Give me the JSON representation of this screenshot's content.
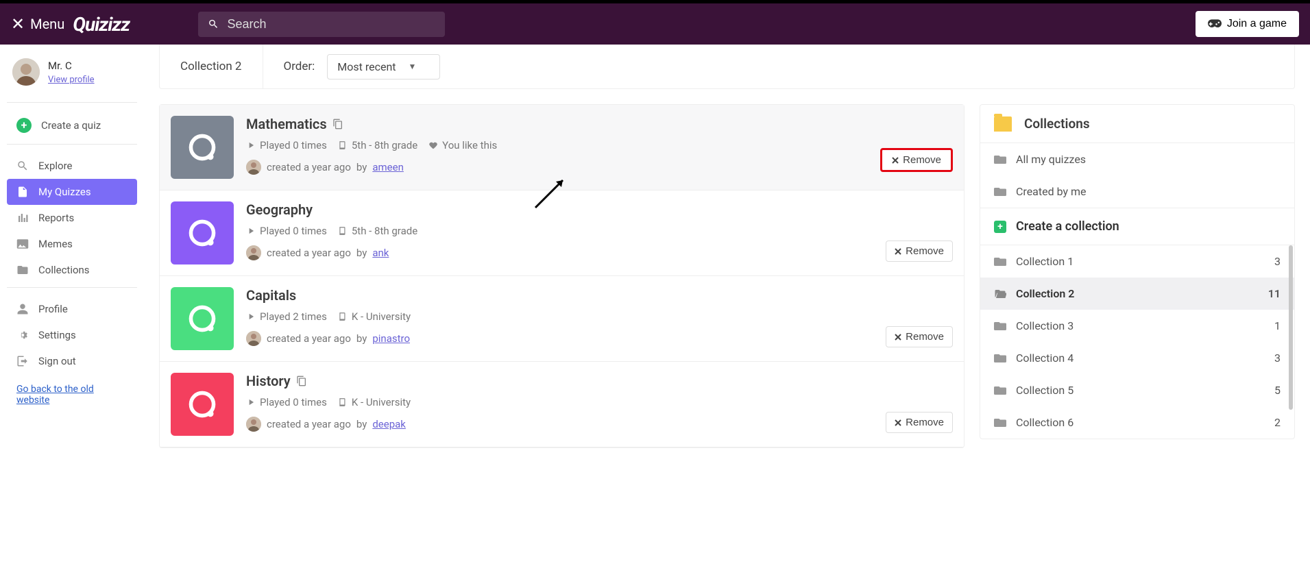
{
  "header": {
    "menu_label": "Menu",
    "logo_text": "Quizizz",
    "search_placeholder": "Search",
    "join_label": "Join a game"
  },
  "profile": {
    "name": "Mr. C",
    "view_profile": "View profile"
  },
  "sidebar": {
    "create": "Create a quiz",
    "explore": "Explore",
    "my_quizzes": "My Quizzes",
    "reports": "Reports",
    "memes": "Memes",
    "collections": "Collections",
    "profile": "Profile",
    "settings": "Settings",
    "signout": "Sign out",
    "old_site": "Go back to the old website"
  },
  "toolbar": {
    "collection_title": "Collection 2",
    "order_label": "Order:",
    "order_value": "Most recent"
  },
  "quizzes": [
    {
      "title": "Mathematics",
      "has_copy": true,
      "thumb_color": "#7c8592",
      "plays": "Played 0 times",
      "grade": "5th - 8th grade",
      "liked": true,
      "like_text": "You like this",
      "created": "created a year ago",
      "by": "by",
      "author": "ameen",
      "remove": "Remove",
      "highlight": true
    },
    {
      "title": "Geography",
      "has_copy": false,
      "thumb_color": "#8b5cf6",
      "plays": "Played 0 times",
      "grade": "5th - 8th grade",
      "liked": false,
      "created": "created a year ago",
      "by": "by",
      "author": "ank",
      "remove": "Remove",
      "highlight": false
    },
    {
      "title": "Capitals",
      "has_copy": false,
      "thumb_color": "#4ade80",
      "plays": "Played 2 times",
      "grade": "K - University",
      "liked": false,
      "created": "created a year ago",
      "by": "by",
      "author": "pinastro",
      "remove": "Remove",
      "highlight": false
    },
    {
      "title": "History",
      "has_copy": true,
      "thumb_color": "#f43f5e",
      "plays": "Played 0 times",
      "grade": "K - University",
      "liked": false,
      "created": "created a year ago",
      "by": "by",
      "author": "deepak",
      "remove": "Remove",
      "highlight": false
    }
  ],
  "rightcol": {
    "header": "Collections",
    "all": "All my quizzes",
    "created_by_me": "Created by me",
    "create_collection": "Create a collection",
    "items": [
      {
        "label": "Collection 1",
        "count": "3",
        "active": false
      },
      {
        "label": "Collection 2",
        "count": "11",
        "active": true
      },
      {
        "label": "Collection 3",
        "count": "1",
        "active": false
      },
      {
        "label": "Collection 4",
        "count": "3",
        "active": false
      },
      {
        "label": "Collection 5",
        "count": "5",
        "active": false
      },
      {
        "label": "Collection 6",
        "count": "2",
        "active": false
      }
    ]
  }
}
